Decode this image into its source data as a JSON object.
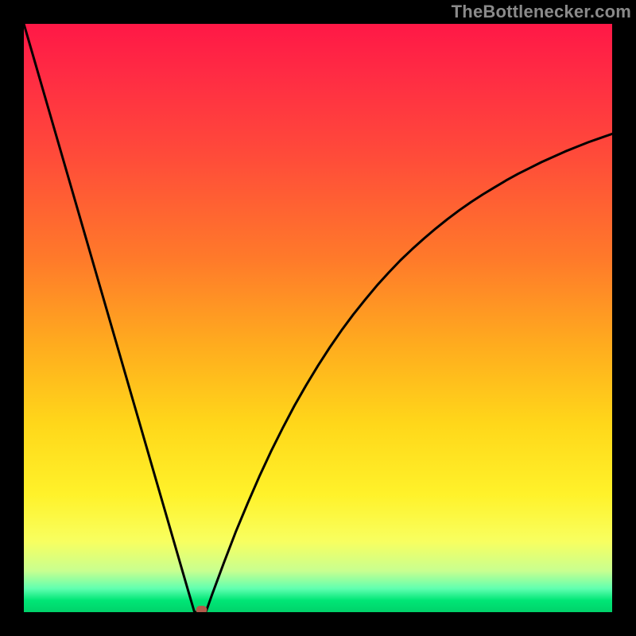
{
  "watermark": "TheBottlenecker.com",
  "chart_data": {
    "type": "line",
    "title": "",
    "xlabel": "",
    "ylabel": "",
    "xlim": [
      0,
      100
    ],
    "ylim": [
      0,
      100
    ],
    "x": [
      0,
      2,
      4,
      6,
      8,
      10,
      12,
      14,
      16,
      18,
      20,
      22,
      24,
      26,
      28,
      29,
      29.5,
      30,
      30.5,
      31,
      32,
      34,
      36,
      38,
      40,
      42,
      44,
      46,
      48,
      50,
      52,
      54,
      56,
      58,
      60,
      62,
      64,
      66,
      68,
      70,
      72,
      74,
      76,
      78,
      80,
      82,
      84,
      86,
      88,
      90,
      92,
      94,
      96,
      98,
      100
    ],
    "values": [
      100,
      93.1,
      86.2,
      79.3,
      72.4,
      65.5,
      58.6,
      51.7,
      44.8,
      37.9,
      31.0,
      24.1,
      17.2,
      10.3,
      3.4,
      0.0,
      0.0,
      0.0,
      0.0,
      0.2,
      3.0,
      8.4,
      13.6,
      18.4,
      23.0,
      27.3,
      31.3,
      35.1,
      38.6,
      41.9,
      45.0,
      47.9,
      50.6,
      53.1,
      55.5,
      57.7,
      59.8,
      61.7,
      63.5,
      65.2,
      66.8,
      68.3,
      69.7,
      71.0,
      72.2,
      73.4,
      74.5,
      75.5,
      76.5,
      77.4,
      78.3,
      79.1,
      79.9,
      80.6,
      81.3
    ],
    "marker": {
      "x": 30.2,
      "y": 0.4
    },
    "gradient_stops": [
      {
        "pos": 0,
        "color": "#ff1846"
      },
      {
        "pos": 22,
        "color": "#ff4a3a"
      },
      {
        "pos": 55,
        "color": "#ffad1e"
      },
      {
        "pos": 80,
        "color": "#fff22a"
      },
      {
        "pos": 96,
        "color": "#60ffb0"
      },
      {
        "pos": 100,
        "color": "#00d26a"
      }
    ]
  }
}
